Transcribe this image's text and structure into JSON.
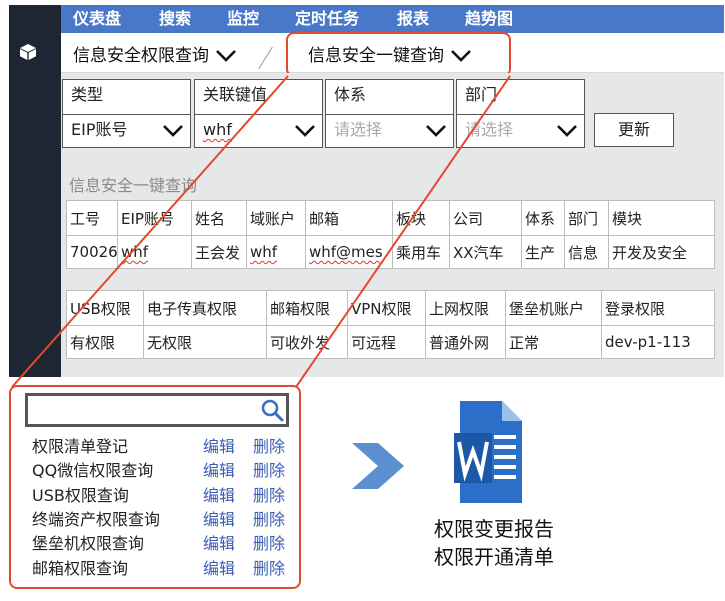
{
  "nav": {
    "items": [
      "仪表盘",
      "搜索",
      "监控",
      "定时任务",
      "报表",
      "趋势图"
    ]
  },
  "tabs": [
    {
      "label": "信息安全权限查询"
    },
    {
      "label": "信息安全一键查询"
    }
  ],
  "filters": {
    "labels": [
      "类型",
      "关联键值",
      "体系",
      "部门"
    ],
    "type_value": "EIP账号",
    "key_value": "whf",
    "system_placeholder": "请选择",
    "dept_placeholder": "请选择",
    "refresh_label": "更新"
  },
  "section_title": "信息安全一键查询",
  "user_table": {
    "headers": [
      "工号",
      "EIP账号",
      "姓名",
      "域账户",
      "邮箱",
      "板块",
      "公司",
      "体系",
      "部门",
      "模块"
    ],
    "row": [
      "70026",
      "whf",
      "王会发",
      "whf",
      "whf@mes",
      "乘用车",
      "XX汽车",
      "生产",
      "信息",
      "开发及安全"
    ]
  },
  "perm_table": {
    "headers": [
      "USB权限",
      "电子传真权限",
      "邮箱权限",
      "VPN权限",
      "上网权限",
      "堡垒机账户",
      "登录权限"
    ],
    "row": [
      "有权限",
      "无权限",
      "可收外发",
      "可远程",
      "普通外网",
      "正常",
      "dev-p1-113"
    ]
  },
  "query_menu": {
    "search_placeholder": "",
    "items": [
      "权限清单登记",
      "QQ微信权限查询",
      "USB权限查询",
      "终端资产权限查询",
      "堡垒机权限查询",
      "邮箱权限查询"
    ],
    "edit_label": "编辑",
    "delete_label": "删除"
  },
  "output": {
    "line1": "权限变更报告",
    "line2": "权限开通清单"
  },
  "colors": {
    "nav_bg": "#4a78c9",
    "rail_bg": "#1f2633",
    "highlight": "#e24a2b",
    "link": "#3a5db5",
    "word_blue": "#2b6fc9",
    "arrow_blue": "#5b8fd0"
  },
  "icons": {
    "rail": "cube-icon",
    "search": "search-icon",
    "arrow": "chevron-right-arrow-icon",
    "document": "word-document-icon"
  }
}
